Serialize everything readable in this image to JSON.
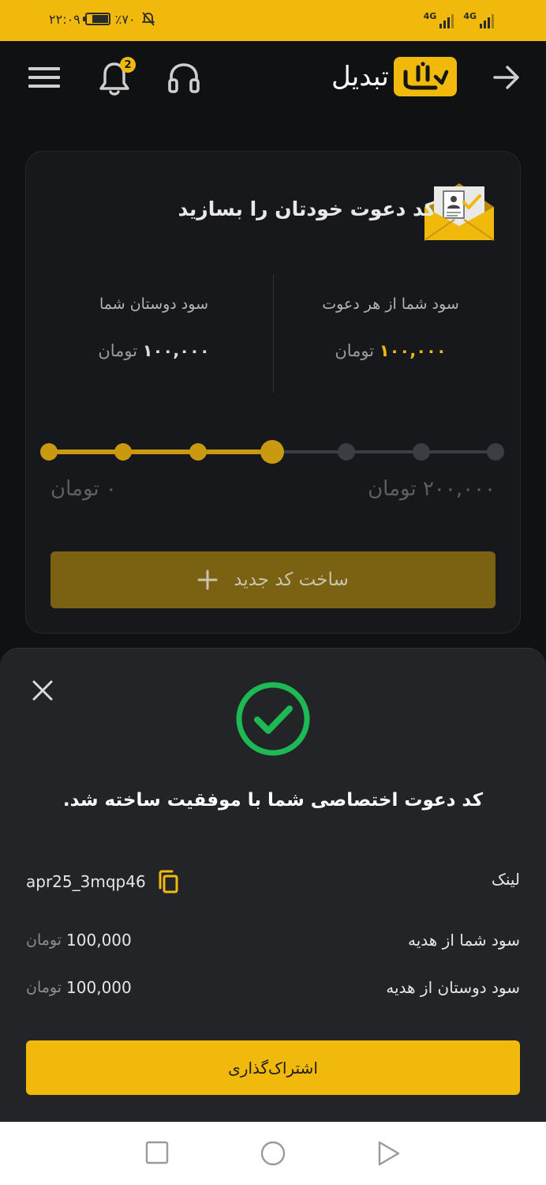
{
  "status_bar": {
    "time": "۲۲:۰۹",
    "battery": "٪۷۰",
    "battery_level": 0.7,
    "network_1": "4G",
    "network_2": "4G"
  },
  "header": {
    "app_name": "تبدیل",
    "notification_count": "2",
    "icons": [
      "back-arrow-icon",
      "headset-icon",
      "bell-icon",
      "menu-icon"
    ]
  },
  "invite_card": {
    "title": "کد دعوت خودتان را بسازید",
    "your_profit_label": "سود شما از هر دعوت",
    "your_profit_value": "۱۰۰,۰۰۰",
    "your_profit_unit": "تومان",
    "friends_profit_label": "سود دوستان شما",
    "friends_profit_value": "۱۰۰,۰۰۰",
    "friends_profit_unit": "تومان",
    "slider_min": "۰ تومان",
    "slider_max": "۲۰۰,۰۰۰ تومان",
    "slider_level": 0.5,
    "create_button": "ساخت کد جدید"
  },
  "success_sheet": {
    "message": "کد دعوت اختصاصی شما با موفقیت ساخته شد.",
    "link_label": "لینک",
    "link_value": "apr25_3mqp46",
    "your_gift_label": "سود شما از هدیه",
    "your_gift_value": "100,000",
    "your_gift_unit": "تومان",
    "friends_gift_label": "سود دوستان از هدیه",
    "friends_gift_value": "100,000",
    "friends_gift_unit": "تومان",
    "share_button": "اشتراک‌گذاری"
  },
  "colors": {
    "brand": "#F0B90B",
    "success": "#1DB954",
    "background": "#101113",
    "sheet": "#232427"
  }
}
